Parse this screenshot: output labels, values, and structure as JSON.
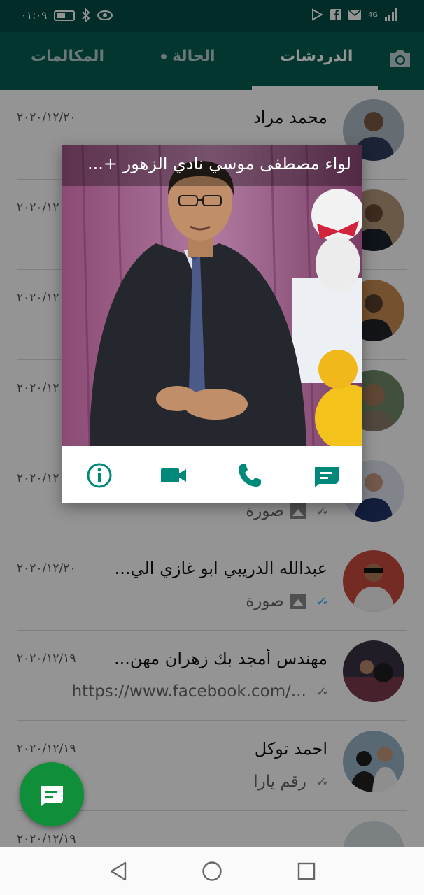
{
  "status_bar": {
    "time": "٠١:٠٩",
    "signal_label": "4G"
  },
  "header": {
    "tabs": [
      {
        "label": "الدردشات",
        "active": true
      },
      {
        "label": "الحالة",
        "active": false
      },
      {
        "label": "المكالمات",
        "active": false
      }
    ]
  },
  "chats": [
    {
      "name": "محمد مراد",
      "date": "٢٠٢٠/١٢/٢٠",
      "preview": ""
    },
    {
      "name": "",
      "date": "٢٠٢٠/١٢",
      "preview": ""
    },
    {
      "name": "",
      "date": "٢٠٢٠/١٢",
      "preview": ""
    },
    {
      "name": "",
      "date": "٢٠٢٠/١٢",
      "preview": ""
    },
    {
      "name": "",
      "date": "٢٠٢٠/١٢",
      "preview": "صورة",
      "ticks": "sent"
    },
    {
      "name": "عبدالله الدريبي ابو غازي الي...",
      "date": "٢٠٢٠/١٢/٢٠",
      "preview": "صورة",
      "ticks": "read"
    },
    {
      "name": "مهندس أمجد بك زهران مهن...",
      "date": "٢٠٢٠/١٢/١٩",
      "preview": "https://www.facebook.com/...",
      "ticks": "sent"
    },
    {
      "name": "احمد توكل",
      "date": "٢٠٢٠/١٢/١٩",
      "preview": "رقم يارا",
      "ticks": "sent"
    },
    {
      "name": "",
      "date": "٢٠٢٠/١٢/١٩",
      "preview": ""
    }
  ],
  "popup": {
    "contact_name": "لواء مصطفى موسي نادي الزهور +..."
  },
  "colors": {
    "header": "#075e54",
    "status_bar": "#054d44",
    "accent": "#00897b",
    "fab": "#0f8f3a",
    "read_ticks": "#34b7f1"
  },
  "icons": {
    "camera": "camera-icon",
    "info": "info-icon",
    "video": "video-call-icon",
    "phone": "phone-icon",
    "message": "message-icon",
    "new_chat": "new-chat-icon"
  }
}
